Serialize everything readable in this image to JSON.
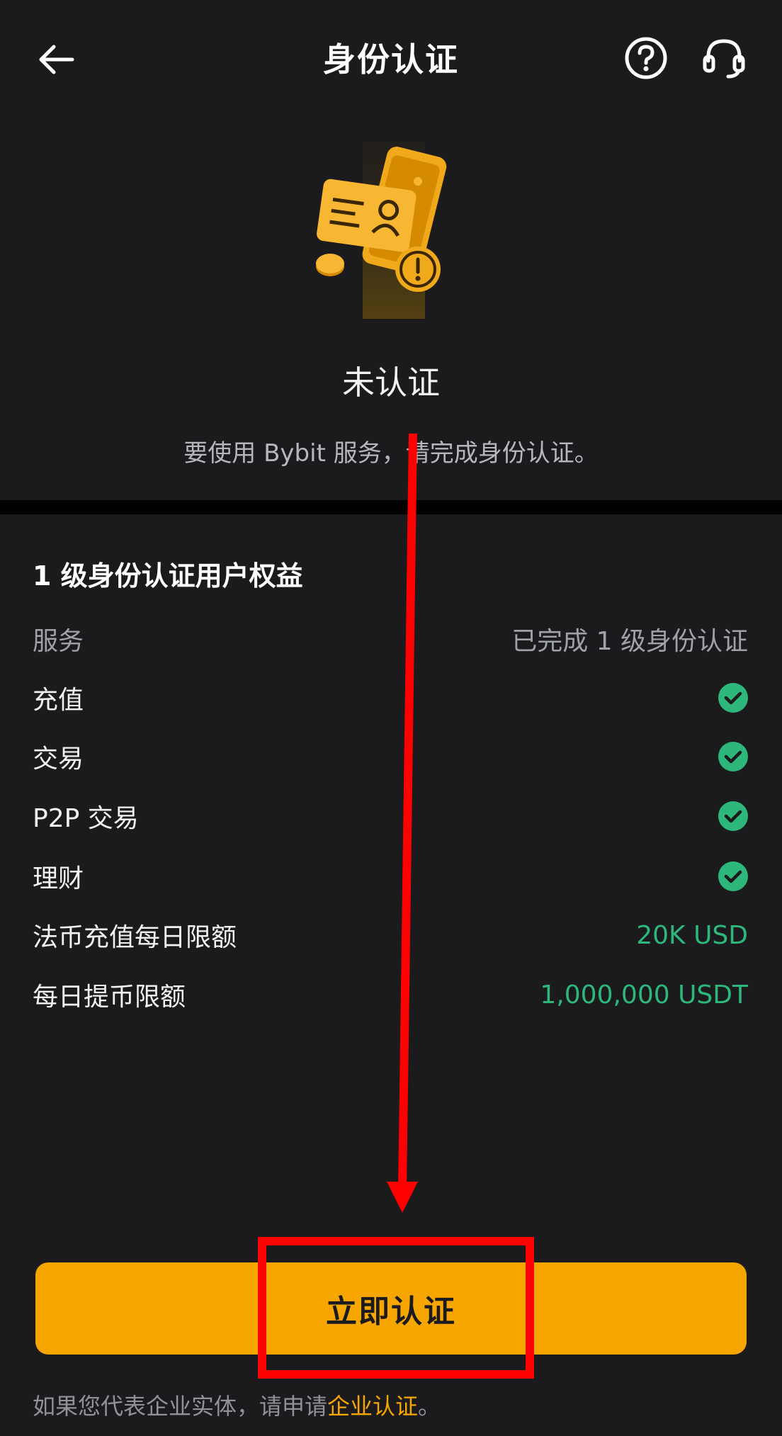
{
  "header": {
    "title": "身份认证",
    "back_icon": "arrow-left-icon",
    "help_icon": "question-circle-icon",
    "support_icon": "headset-icon"
  },
  "hero": {
    "illustration": "id-card-phone-warning-illustration",
    "status": "未认证",
    "description": "要使用 Bybit 服务，请完成身份认证。"
  },
  "benefits": {
    "title": "1 级身份认证用户权益",
    "header_row": {
      "label": "服务",
      "value": "已完成 1 级身份认证"
    },
    "rows": [
      {
        "label": "充值",
        "icon": "check-circle-icon"
      },
      {
        "label": "交易",
        "icon": "check-circle-icon"
      },
      {
        "label": "P2P 交易",
        "icon": "check-circle-icon"
      },
      {
        "label": "理财",
        "icon": "check-circle-icon"
      }
    ],
    "limits": [
      {
        "label": "法币充值每日限额",
        "value": "20K USD"
      },
      {
        "label": "每日提币限额",
        "value": "1,000,000 USDT"
      }
    ]
  },
  "cta": {
    "label": "立即认证"
  },
  "footer": {
    "text": "如果您代表企业实体，请申请",
    "link": "企业认证",
    "suffix": "。"
  },
  "colors": {
    "background": "#1b1b1e",
    "accent": "#f7a600",
    "success": "#2db77a",
    "annotation": "#ff0000"
  }
}
